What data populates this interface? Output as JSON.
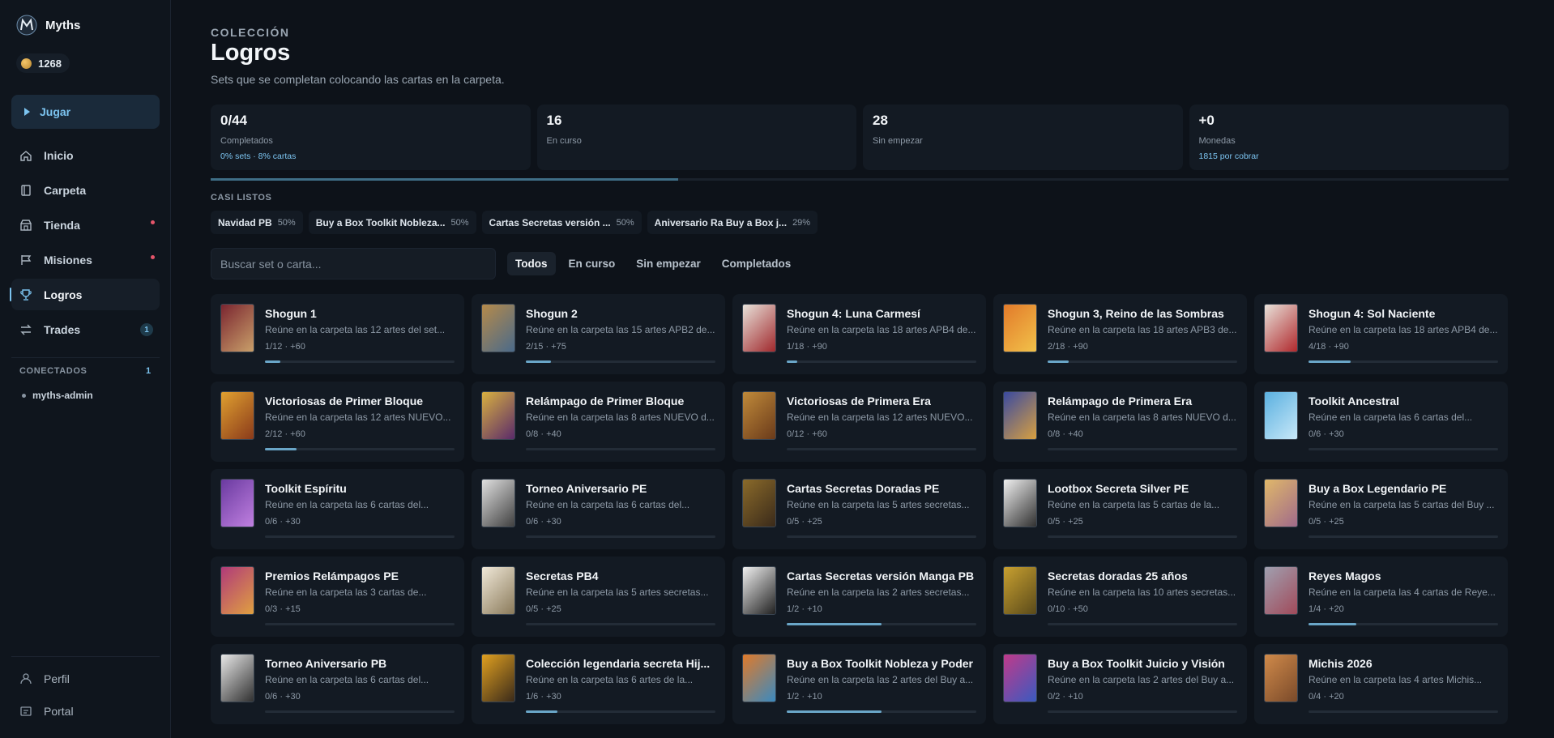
{
  "sidebar": {
    "brand": "Myths",
    "coins": "1268",
    "play_label": "Jugar",
    "nav": [
      {
        "label": "Inicio",
        "icon": "home-icon"
      },
      {
        "label": "Carpeta",
        "icon": "binder-icon"
      },
      {
        "label": "Tienda",
        "icon": "store-icon",
        "dot": true
      },
      {
        "label": "Misiones",
        "icon": "flag-icon",
        "dot": true
      },
      {
        "label": "Logros",
        "icon": "trophy-icon",
        "active": true
      },
      {
        "label": "Trades",
        "icon": "swap-icon",
        "badge": "1"
      }
    ],
    "connected_title": "CONECTADOS",
    "connected_count": "1",
    "connected_user": "myths-admin",
    "bottom": [
      {
        "label": "Perfil",
        "icon": "user-icon"
      },
      {
        "label": "Portal",
        "icon": "portal-icon"
      }
    ]
  },
  "header": {
    "kicker": "COLECCIÓN",
    "title": "Logros",
    "subtitle": "Sets que se completan colocando las cartas en la carpeta."
  },
  "stats": [
    {
      "value": "0/44",
      "label": "Completados",
      "sub": "0% sets · 8% cartas"
    },
    {
      "value": "16",
      "label": "En curso",
      "sub": ""
    },
    {
      "value": "28",
      "label": "Sin empezar",
      "sub": ""
    },
    {
      "value": "+0",
      "label": "Monedas",
      "sub": "1815 por cobrar"
    }
  ],
  "overall_progress": 0.36,
  "casi_listos": {
    "title": "CASI LISTOS",
    "items": [
      {
        "name": "Navidad PB",
        "pct": "50%"
      },
      {
        "name": "Buy a Box Toolkit Nobleza...",
        "pct": "50%"
      },
      {
        "name": "Cartas Secretas versión ...",
        "pct": "50%"
      },
      {
        "name": "Aniversario Ra Buy a Box j...",
        "pct": "29%"
      }
    ]
  },
  "search": {
    "placeholder": "Buscar set o carta..."
  },
  "filters": [
    {
      "label": "Todos",
      "active": true
    },
    {
      "label": "En curso"
    },
    {
      "label": "Sin empezar"
    },
    {
      "label": "Completados"
    }
  ],
  "colors": {
    "accent": "#7cc4f0",
    "progress": "#6aa6c8",
    "alert": "#e5556a"
  },
  "cards": [
    {
      "title": "Shogun 1",
      "desc": "Reúne en la carpeta las 12 artes del set...",
      "meta": "1/12 · +60",
      "progress": 0.083,
      "thumb": [
        "#7a2530",
        "#c9a06a"
      ]
    },
    {
      "title": "Shogun 2",
      "desc": "Reúne en la carpeta las 15 artes APB2 de...",
      "meta": "2/15 · +75",
      "progress": 0.133,
      "thumb": [
        "#b58a4a",
        "#4a6a8a"
      ]
    },
    {
      "title": "Shogun 4: Luna Carmesí",
      "desc": "Reúne en la carpeta las 18 artes APB4 de...",
      "meta": "1/18 · +90",
      "progress": 0.056,
      "thumb": [
        "#e8e2da",
        "#a0282c"
      ]
    },
    {
      "title": "Shogun 3, Reino de las Sombras",
      "desc": "Reúne en la carpeta las 18 artes APB3 de...",
      "meta": "2/18 · +90",
      "progress": 0.111,
      "thumb": [
        "#e27a2a",
        "#f2c24a"
      ]
    },
    {
      "title": "Shogun 4: Sol Naciente",
      "desc": "Reúne en la carpeta las 18 artes APB4 de...",
      "meta": "4/18 · +90",
      "progress": 0.222,
      "thumb": [
        "#e8e2da",
        "#b0282c"
      ]
    },
    {
      "title": "Victoriosas de Primer Bloque",
      "desc": "Reúne en la carpeta las 12 artes NUEVO...",
      "meta": "2/12 · +60",
      "progress": 0.167,
      "thumb": [
        "#e0a030",
        "#8a3a1a"
      ]
    },
    {
      "title": "Relámpago de Primer Bloque",
      "desc": "Reúne en la carpeta las 8 artes NUEVO d...",
      "meta": "0/8 · +40",
      "progress": 0,
      "thumb": [
        "#d8b040",
        "#5a2a6a"
      ]
    },
    {
      "title": "Victoriosas de Primera Era",
      "desc": "Reúne en la carpeta las 12 artes NUEVO...",
      "meta": "0/12 · +60",
      "progress": 0,
      "thumb": [
        "#c08a3a",
        "#6a3a1a"
      ]
    },
    {
      "title": "Relámpago de Primera Era",
      "desc": "Reúne en la carpeta las 8 artes NUEVO d...",
      "meta": "0/8 · +40",
      "progress": 0,
      "thumb": [
        "#3a4aa0",
        "#d8a040"
      ]
    },
    {
      "title": "Toolkit Ancestral",
      "desc": "Reúne en la carpeta las 6 cartas del...",
      "meta": "0/6 · +30",
      "progress": 0,
      "thumb": [
        "#5ab0e0",
        "#c8e8f8"
      ]
    },
    {
      "title": "Toolkit Espíritu",
      "desc": "Reúne en la carpeta las 6 cartas del...",
      "meta": "0/6 · +30",
      "progress": 0,
      "thumb": [
        "#6a3aa0",
        "#c080e0"
      ]
    },
    {
      "title": "Torneo Aniversario PE",
      "desc": "Reúne en la carpeta las 6 cartas del...",
      "meta": "0/6 · +30",
      "progress": 0,
      "thumb": [
        "#e0e0e0",
        "#404040"
      ]
    },
    {
      "title": "Cartas Secretas Doradas PE",
      "desc": "Reúne en la carpeta las 5 artes secretas...",
      "meta": "0/5 · +25",
      "progress": 0,
      "thumb": [
        "#8a6a2a",
        "#3a2a1a"
      ]
    },
    {
      "title": "Lootbox Secreta Silver PE",
      "desc": "Reúne en la carpeta las 5 cartas de la...",
      "meta": "0/5 · +25",
      "progress": 0,
      "thumb": [
        "#f0f0f0",
        "#303030"
      ]
    },
    {
      "title": "Buy a Box Legendario PE",
      "desc": "Reúne en la carpeta las 5 cartas del Buy ...",
      "meta": "0/5 · +25",
      "progress": 0,
      "thumb": [
        "#e0b86a",
        "#a06a8a"
      ]
    },
    {
      "title": "Premios Relámpagos PE",
      "desc": "Reúne en la carpeta las 3 cartas de...",
      "meta": "0/3 · +15",
      "progress": 0,
      "thumb": [
        "#b03a7a",
        "#e0a040"
      ]
    },
    {
      "title": "Secretas PB4",
      "desc": "Reúne en la carpeta las 5 artes secretas...",
      "meta": "0/5 · +25",
      "progress": 0,
      "thumb": [
        "#f0e8d8",
        "#8a7a5a"
      ]
    },
    {
      "title": "Cartas Secretas versión Manga PB",
      "desc": "Reúne en la carpeta las 2 artes secretas...",
      "meta": "1/2 · +10",
      "progress": 0.5,
      "thumb": [
        "#f0f0f0",
        "#202020"
      ]
    },
    {
      "title": "Secretas doradas 25 años",
      "desc": "Reúne en la carpeta las 10 artes secretas...",
      "meta": "0/10 · +50",
      "progress": 0,
      "thumb": [
        "#c8a030",
        "#5a4a1a"
      ]
    },
    {
      "title": "Reyes Magos",
      "desc": "Reúne en la carpeta las 4 cartas de Reye...",
      "meta": "1/4 · +20",
      "progress": 0.25,
      "thumb": [
        "#a0a0b0",
        "#a04a5a"
      ]
    },
    {
      "title": "Torneo Aniversario PB",
      "desc": "Reúne en la carpeta las 6 cartas del...",
      "meta": "0/6 · +30",
      "progress": 0,
      "thumb": [
        "#e8e8e8",
        "#303030"
      ]
    },
    {
      "title": "Colección legendaria secreta Hij...",
      "desc": "Reúne en la carpeta las 6 artes de la...",
      "meta": "1/6 · +30",
      "progress": 0.167,
      "thumb": [
        "#e0a020",
        "#3a2a1a"
      ]
    },
    {
      "title": "Buy a Box Toolkit Nobleza y Poder",
      "desc": "Reúne en la carpeta las 2 artes del Buy a...",
      "meta": "1/2 · +10",
      "progress": 0.5,
      "thumb": [
        "#e07a2a",
        "#3a8ac0"
      ]
    },
    {
      "title": "Buy a Box Toolkit Juicio y Visión",
      "desc": "Reúne en la carpeta las 2 artes del Buy a...",
      "meta": "0/2 · +10",
      "progress": 0,
      "thumb": [
        "#c03a8a",
        "#3a5ac0"
      ]
    },
    {
      "title": "Michis 2026",
      "desc": "Reúne en la carpeta las 4 artes Michis...",
      "meta": "0/4 · +20",
      "progress": 0,
      "thumb": [
        "#d08a4a",
        "#7a4a2a"
      ]
    }
  ]
}
